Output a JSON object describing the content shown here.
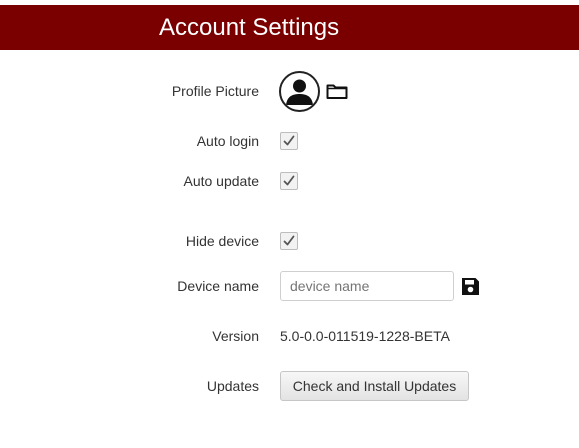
{
  "header": {
    "title": "Account Settings",
    "background_color": "#7a0000"
  },
  "settings": {
    "profile_picture": {
      "label": "Profile Picture",
      "avatar_icon": "user-avatar-icon",
      "browse_icon": "folder-icon"
    },
    "auto_login": {
      "label": "Auto login",
      "checked": true
    },
    "auto_update": {
      "label": "Auto update",
      "checked": true
    },
    "hide_device": {
      "label": "Hide device",
      "checked": true
    },
    "device_name": {
      "label": "Device name",
      "value": "",
      "placeholder": "device name",
      "save_icon": "save-icon"
    },
    "version": {
      "label": "Version",
      "value": "5.0-0.0-011519-1228-BETA"
    },
    "updates": {
      "label": "Updates",
      "button_label": "Check and Install Updates"
    }
  }
}
